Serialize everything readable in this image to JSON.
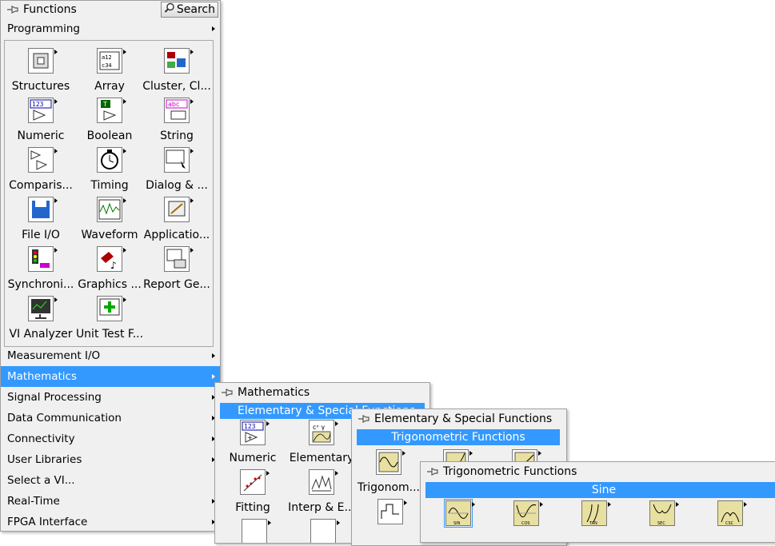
{
  "functions_palette": {
    "title": "Functions",
    "search_label": "Search",
    "programming_label": "Programming",
    "programming_items": [
      {
        "label": "Structures",
        "icon": "structures-icon"
      },
      {
        "label": "Array",
        "icon": "array-icon"
      },
      {
        "label": "Cluster, Cl...",
        "icon": "cluster-icon"
      },
      {
        "label": "Numeric",
        "icon": "numeric-icon"
      },
      {
        "label": "Boolean",
        "icon": "boolean-icon"
      },
      {
        "label": "String",
        "icon": "string-icon"
      },
      {
        "label": "Comparis...",
        "icon": "comparison-icon"
      },
      {
        "label": "Timing",
        "icon": "timing-icon"
      },
      {
        "label": "Dialog & ...",
        "icon": "dialog-icon"
      },
      {
        "label": "File I/O",
        "icon": "file-io-icon"
      },
      {
        "label": "Waveform",
        "icon": "waveform-icon"
      },
      {
        "label": "Applicatio...",
        "icon": "application-control-icon"
      },
      {
        "label": "Synchroni...",
        "icon": "synchronization-icon"
      },
      {
        "label": "Graphics ...",
        "icon": "graphics-sound-icon"
      },
      {
        "label": "Report Ge...",
        "icon": "report-generation-icon"
      },
      {
        "label": "VI Analyzer",
        "icon": "vi-analyzer-icon"
      },
      {
        "label": "Unit Test F...",
        "icon": "unit-test-icon"
      }
    ],
    "categories": [
      {
        "label": "Measurement I/O",
        "selected": false
      },
      {
        "label": "Mathematics",
        "selected": true
      },
      {
        "label": "Signal Processing",
        "selected": false
      },
      {
        "label": "Data Communication",
        "selected": false
      },
      {
        "label": "Connectivity",
        "selected": false
      },
      {
        "label": "User Libraries",
        "selected": false
      },
      {
        "label": "Select a VI...",
        "selected": false
      },
      {
        "label": "Real-Time",
        "selected": false
      },
      {
        "label": "FPGA Interface",
        "selected": false
      }
    ]
  },
  "mathematics_palette": {
    "title": "Mathematics",
    "selected_label": "Elementary & Special Functions",
    "items": [
      {
        "label": "Numeric"
      },
      {
        "label": "Elementary"
      },
      {
        "label": "Fitting"
      },
      {
        "label": "Interp & E..."
      }
    ]
  },
  "elementary_palette": {
    "title": "Elementary & Special Functions",
    "selected_label": "Trigonometric Functions",
    "items": [
      {
        "label": "Trigonom..."
      }
    ]
  },
  "trig_palette": {
    "title": "Trigonometric Functions",
    "selected_label": "Sine",
    "items": [
      {
        "label": "SIN"
      },
      {
        "label": "COS"
      },
      {
        "label": "TAN"
      },
      {
        "label": "SEC"
      },
      {
        "label": "CSC"
      }
    ]
  },
  "colors": {
    "selection": "#3399ff",
    "panel_bg": "#f0f0f0"
  }
}
